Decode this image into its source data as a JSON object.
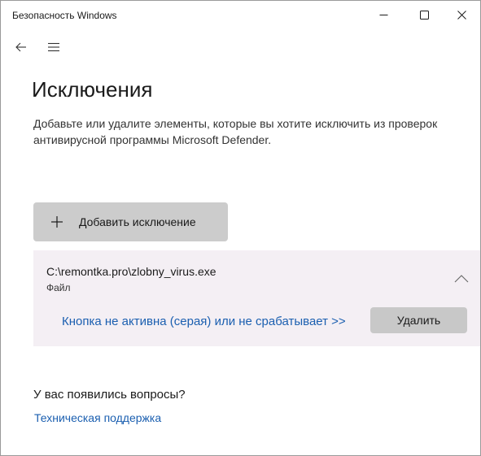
{
  "window": {
    "title": "Безопасность Windows"
  },
  "titlebar_icons": {
    "minimize": "minimize-icon",
    "maximize": "maximize-icon",
    "close": "close-icon"
  },
  "nav": {
    "back_icon": "back-arrow-icon",
    "menu_icon": "hamburger-menu-icon"
  },
  "page": {
    "title": "Исключения",
    "description": "Добавьте или удалите элементы, которые вы хотите исключить из проверок антивирусной программы Microsoft Defender."
  },
  "add_button": {
    "label": "Добавить исключение",
    "icon": "plus-icon"
  },
  "exclusion": {
    "path": "C:\\remontka.pro\\zlobny_virus.exe",
    "type": "Файл",
    "chevron_icon": "chevron-up-icon",
    "hint_link": "Кнопка не активна (серая) или не срабатывает >>",
    "delete_label": "Удалить"
  },
  "help": {
    "heading": "У вас появились вопросы?",
    "support_link": "Техническая поддержка"
  },
  "colors": {
    "panel_background": "#f4eff4",
    "button_background": "#cccccc",
    "link": "#1b5fb0"
  }
}
